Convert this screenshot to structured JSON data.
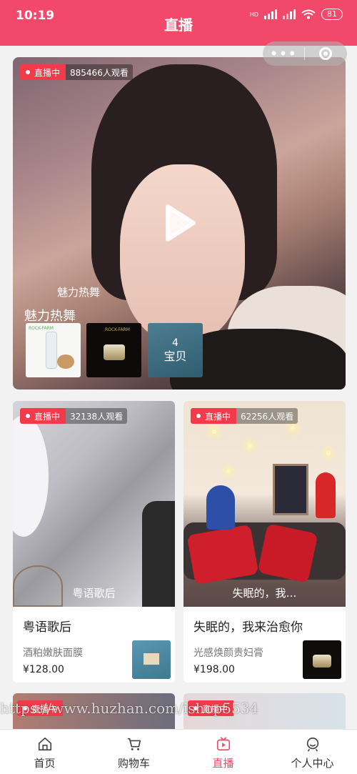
{
  "status": {
    "time": "10:19",
    "battery": "81",
    "network": "HD"
  },
  "header": {
    "title": "直播"
  },
  "capsule": {
    "menu": "•••"
  },
  "featured": {
    "live_label": "直播中",
    "viewers": "885466人观看",
    "caption": "魅力热舞",
    "title": "魅力热舞",
    "products": [
      {
        "text": "ROCK-FARM"
      },
      {
        "text": "ROCK-FARM"
      }
    ],
    "more": {
      "count": "4",
      "label": "宝贝"
    }
  },
  "cards": [
    {
      "live_label": "直播中",
      "viewers": "32138人观看",
      "caption": "粤语歌后",
      "title": "粤语歌后",
      "product": "酒粕嫩肤面膜",
      "price": "¥128.00"
    },
    {
      "live_label": "直播中",
      "viewers": "62256人观看",
      "caption": "失眠的，我…",
      "title": "失眠的，我来治愈你",
      "product": "光感焕颜贵妇膏",
      "price": "¥198.00"
    }
  ],
  "peek": [
    {
      "live_label": "直播中"
    },
    {
      "live_label": "直播中"
    }
  ],
  "watermark": "https://www.huzhan.com/ishop5534",
  "nav": [
    {
      "label": "首页",
      "icon": "home-icon",
      "active": false
    },
    {
      "label": "购物车",
      "icon": "cart-icon",
      "active": false
    },
    {
      "label": "直播",
      "icon": "live-icon",
      "active": true
    },
    {
      "label": "个人中心",
      "icon": "user-icon",
      "active": false
    }
  ],
  "colors": {
    "brand": "#f2496a",
    "live": "#f23a4a"
  }
}
